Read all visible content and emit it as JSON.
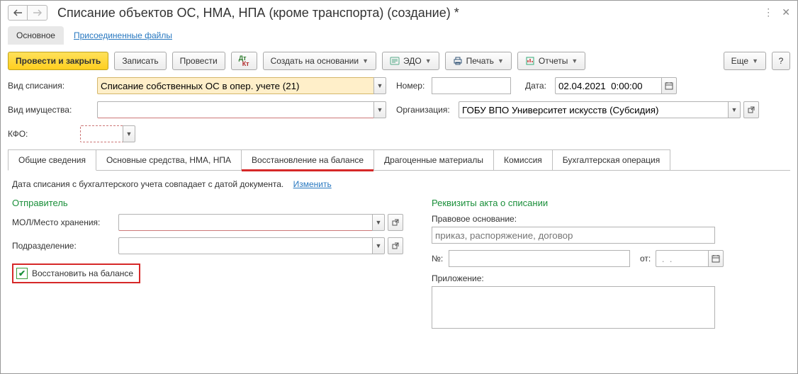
{
  "header": {
    "title": "Списание объектов ОС, НМА, НПА (кроме транспорта) (создание) *"
  },
  "top_tabs": {
    "main": "Основное",
    "files": "Присоединенные файлы"
  },
  "toolbar": {
    "post_close": "Провести и закрыть",
    "save": "Записать",
    "post": "Провести",
    "create_based": "Создать на основании",
    "edo": "ЭДО",
    "print": "Печать",
    "reports": "Отчеты",
    "more": "Еще",
    "help": "?"
  },
  "fields": {
    "writeoff_type_label": "Вид списания:",
    "writeoff_type_value": "Списание собственных ОС в опер. учете (21)",
    "number_label": "Номер:",
    "number_value": "",
    "date_label": "Дата:",
    "date_value": "02.04.2021  0:00:00",
    "asset_type_label": "Вид имущества:",
    "asset_type_value": "",
    "org_label": "Организация:",
    "org_value": "ГОБУ ВПО Университет искусств (Субсидия)",
    "kfo_label": "КФО:",
    "kfo_value": ""
  },
  "main_tabs": {
    "general": "Общие сведения",
    "assets": "Основные средства, НМА, НПА",
    "restore": "Восстановление на балансе",
    "precious": "Драгоценные материалы",
    "commission": "Комиссия",
    "accounting": "Бухгалтерская операция"
  },
  "body": {
    "hint": "Дата списания с бухгалтерского учета совпадает с датой документа.",
    "change_link": "Изменить",
    "sender_title": "Отправитель",
    "mol_label": "МОЛ/Место хранения:",
    "dept_label": "Подразделение:",
    "restore_checkbox": "Восстановить на балансе",
    "act_title": "Реквизиты акта о списании",
    "legal_label": "Правовое основание:",
    "legal_placeholder": "приказ, распоряжение, договор",
    "no_label": "№:",
    "ot_label": "от:",
    "ot_value": " .  .",
    "attachment_label": "Приложение:"
  }
}
